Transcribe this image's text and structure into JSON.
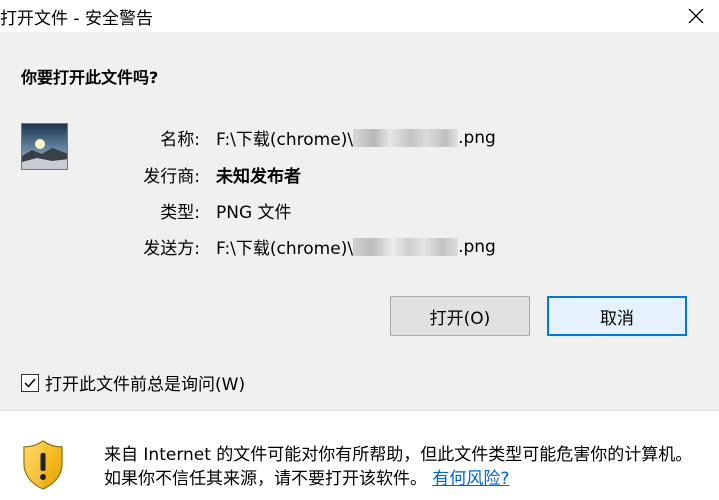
{
  "window": {
    "title": "打开文件 - 安全警告"
  },
  "dialog": {
    "question": "你要打开此文件吗?",
    "fields": [
      {
        "label": "名称:",
        "value_prefix": "F:\\下载(chrome)\\",
        "value_suffix": ".png"
      },
      {
        "label": "发行商:",
        "value": "未知发布者"
      },
      {
        "label": "类型:",
        "value": "PNG 文件"
      },
      {
        "label": "发送方:",
        "value_prefix": "F:\\下载(chrome)\\",
        "value_suffix": ".png"
      }
    ],
    "buttons": {
      "open": "打开(O)",
      "cancel": "取消"
    },
    "checkbox": {
      "label": "打开此文件前总是询问(W)",
      "checked": true
    }
  },
  "warning": {
    "text": "来自 Internet 的文件可能对你有所帮助，但此文件类型可能危害你的计算机。如果你不信任其来源，请不要打开该软件。",
    "link": "有何风险?"
  },
  "colors": {
    "accent": "#0078d7",
    "link": "#0066cc",
    "panel": "#f0f0f0"
  },
  "icons": {
    "close": "close-icon",
    "check": "checkmark-icon",
    "shield": "shield-warning-icon",
    "thumbnail": "file-thumbnail"
  }
}
